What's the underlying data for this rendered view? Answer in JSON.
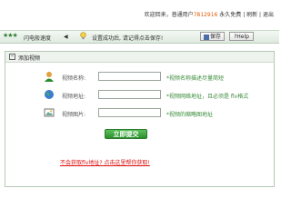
{
  "header": {
    "welcome_prefix": "欢迎回来，普通用户",
    "user_id": "7812916",
    "membership": "永久免费",
    "refresh": "刷新",
    "exit": "退出"
  },
  "toolbar": {
    "stars": "★★★",
    "speed_label": "闪电般速度",
    "speed_arrow": "◀",
    "message": "设置成功后, 请记得点击保存!",
    "save_label": "保存",
    "help_label": "?Help"
  },
  "panel": {
    "title": "添加视频",
    "toggle": "−",
    "rows": [
      {
        "label": "视频名称:",
        "value": "",
        "hint": "*视频名称描述尽量简短"
      },
      {
        "label": "视频地址:",
        "value": "",
        "hint": "*视频网络地址，且必须是 flv格式"
      },
      {
        "label": "视频图片:",
        "value": "",
        "hint": "*视频的缩略图地址"
      }
    ],
    "submit_label": "立即提交",
    "help_link": "不会获取flv地址? 点击这里帮你获取!"
  },
  "colors": {
    "accent_green": "#2c8f2c",
    "hint_green": "#3a8a3a",
    "link_red": "#dd1111",
    "id_orange": "#e05a00"
  }
}
